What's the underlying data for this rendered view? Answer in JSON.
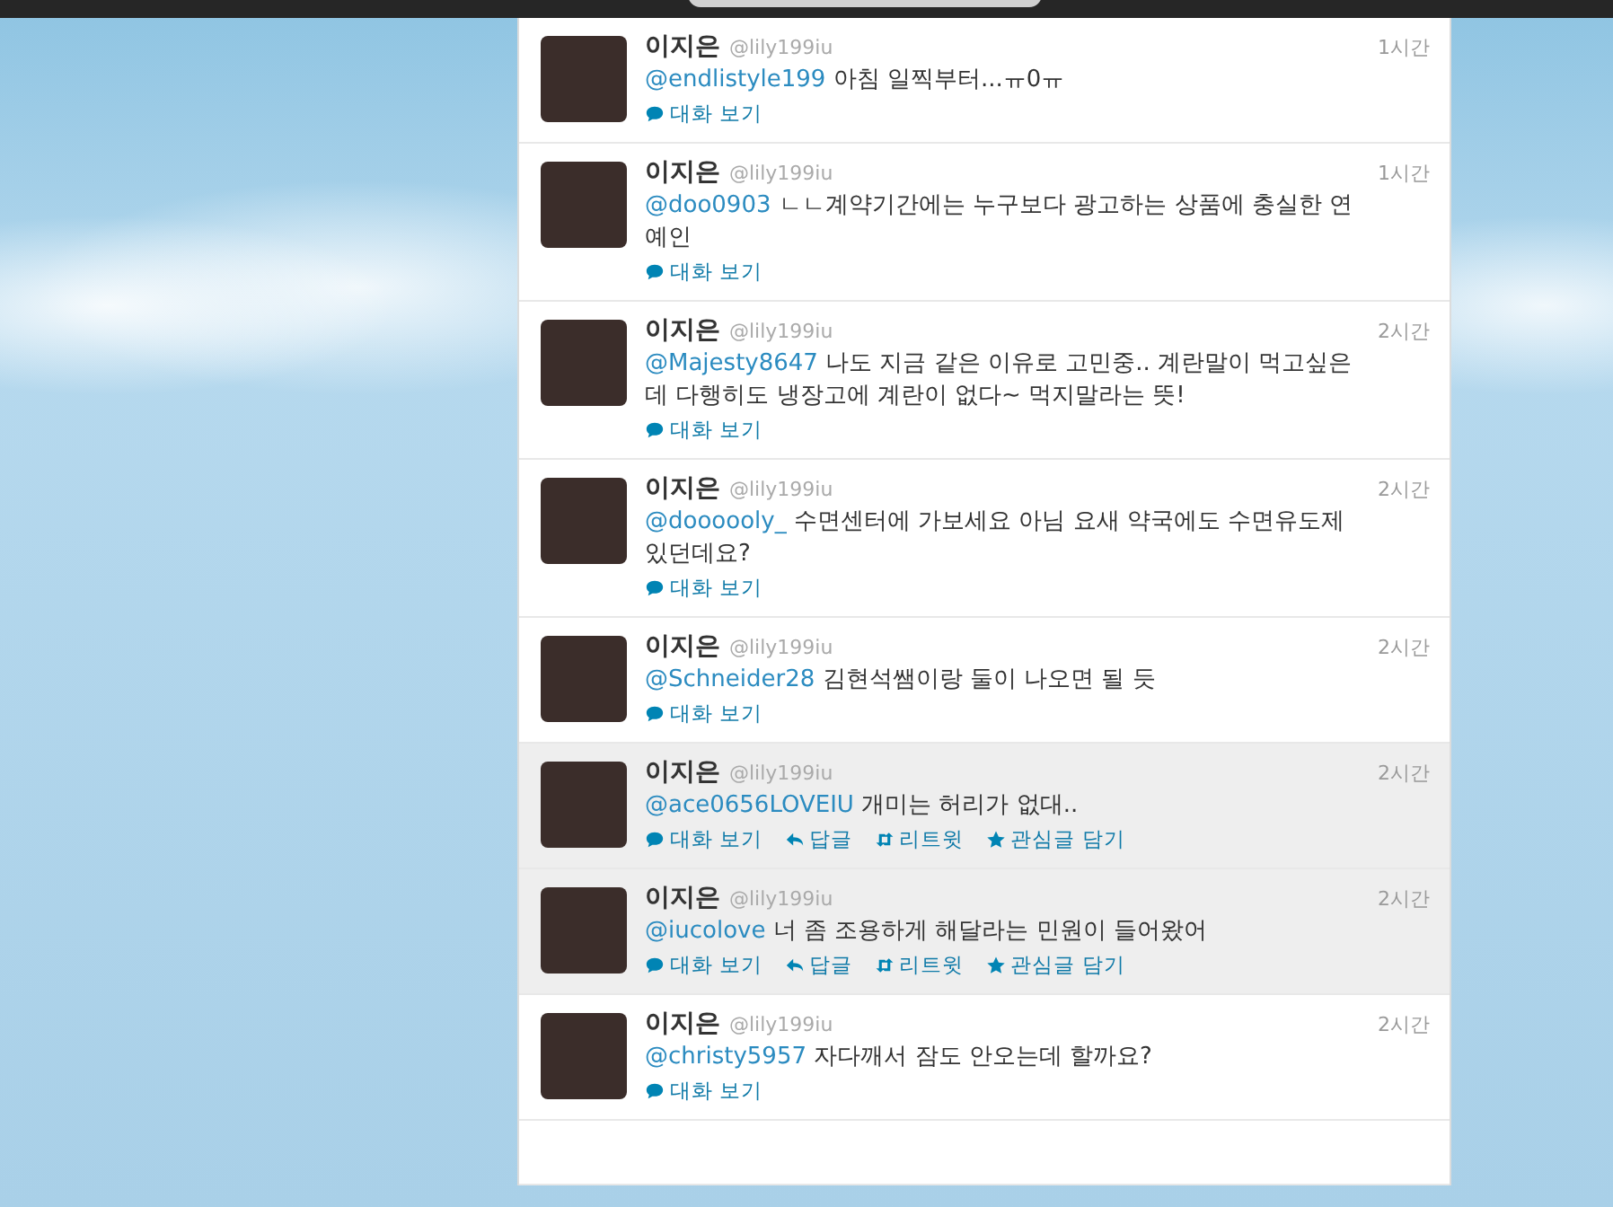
{
  "tweets": [
    {
      "name": "이지은",
      "handle": "@lily199iu",
      "time": "1시간",
      "mention": "@endlistyle199",
      "text": "아침 일찍부터...ㅠ0ㅠ",
      "hovered": false,
      "actions": [
        {
          "kind": "conversation",
          "label": "대화 보기"
        }
      ]
    },
    {
      "name": "이지은",
      "handle": "@lily199iu",
      "time": "1시간",
      "mention": "@doo0903",
      "text": "ㄴㄴ계약기간에는 누구보다 광고하는 상품에 충실한 연예인",
      "hovered": false,
      "actions": [
        {
          "kind": "conversation",
          "label": "대화 보기"
        }
      ]
    },
    {
      "name": "이지은",
      "handle": "@lily199iu",
      "time": "2시간",
      "mention": "@Majesty8647",
      "text": "나도 지금 같은 이유로 고민중.. 계란말이 먹고싶은데 다행히도 냉장고에 계란이 없다~ 먹지말라는 뜻!",
      "hovered": false,
      "actions": [
        {
          "kind": "conversation",
          "label": "대화 보기"
        }
      ]
    },
    {
      "name": "이지은",
      "handle": "@lily199iu",
      "time": "2시간",
      "mention": "@doooooly_",
      "text": "수면센터에 가보세요 아님 요새 약국에도 수면유도제 있던데요?",
      "hovered": false,
      "actions": [
        {
          "kind": "conversation",
          "label": "대화 보기"
        }
      ]
    },
    {
      "name": "이지은",
      "handle": "@lily199iu",
      "time": "2시간",
      "mention": "@Schneider28",
      "text": "김현석쌤이랑 둘이 나오면 될 듯",
      "hovered": false,
      "actions": [
        {
          "kind": "conversation",
          "label": "대화 보기"
        }
      ]
    },
    {
      "name": "이지은",
      "handle": "@lily199iu",
      "time": "2시간",
      "mention": "@ace0656LOVEIU",
      "text": "개미는 허리가 없대..",
      "hovered": true,
      "actions": [
        {
          "kind": "conversation",
          "label": "대화 보기"
        },
        {
          "kind": "reply",
          "label": "답글"
        },
        {
          "kind": "retweet",
          "label": "리트윗"
        },
        {
          "kind": "favorite",
          "label": "관심글 담기"
        }
      ]
    },
    {
      "name": "이지은",
      "handle": "@lily199iu",
      "time": "2시간",
      "mention": "@iucolove",
      "text": "너 좀 조용하게 해달라는 민원이 들어왔어",
      "hovered": true,
      "actions": [
        {
          "kind": "conversation",
          "label": "대화 보기"
        },
        {
          "kind": "reply",
          "label": "답글"
        },
        {
          "kind": "retweet",
          "label": "리트윗"
        },
        {
          "kind": "favorite",
          "label": "관심글 담기"
        }
      ]
    },
    {
      "name": "이지은",
      "handle": "@lily199iu",
      "time": "2시간",
      "mention": "@christy5957",
      "text": "자다깨서 잠도 안오는데 할까요?",
      "hovered": false,
      "actions": [
        {
          "kind": "conversation",
          "label": "대화 보기"
        }
      ]
    }
  ]
}
